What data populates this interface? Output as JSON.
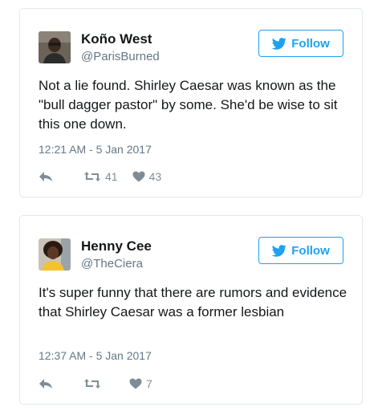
{
  "colors": {
    "accent": "#1da1f2",
    "text": "#14171a",
    "muted": "#657786",
    "border": "#e1e8ed"
  },
  "tweets": [
    {
      "name": "Koño West",
      "handle": "@ParisBurned",
      "follow_label": "Follow",
      "text": "Not a lie found. Shirley Caesar was known as the \"bull dagger pastor\" by some. She'd be wise to sit this one down.",
      "timestamp": "12:21 AM - 5 Jan 2017",
      "retweets": "41",
      "likes": "43",
      "icons": [
        "twitter-bird-icon",
        "reply-icon",
        "retweet-icon",
        "heart-icon"
      ]
    },
    {
      "name": "Henny Cee",
      "handle": "@TheCiera",
      "follow_label": "Follow",
      "text": "It's super funny that there are rumors and evidence that Shirley Caesar was a former lesbian",
      "timestamp": "12:37 AM - 5 Jan 2017",
      "retweets": "",
      "likes": "7",
      "icons": [
        "twitter-bird-icon",
        "reply-icon",
        "retweet-icon",
        "heart-icon"
      ]
    }
  ]
}
